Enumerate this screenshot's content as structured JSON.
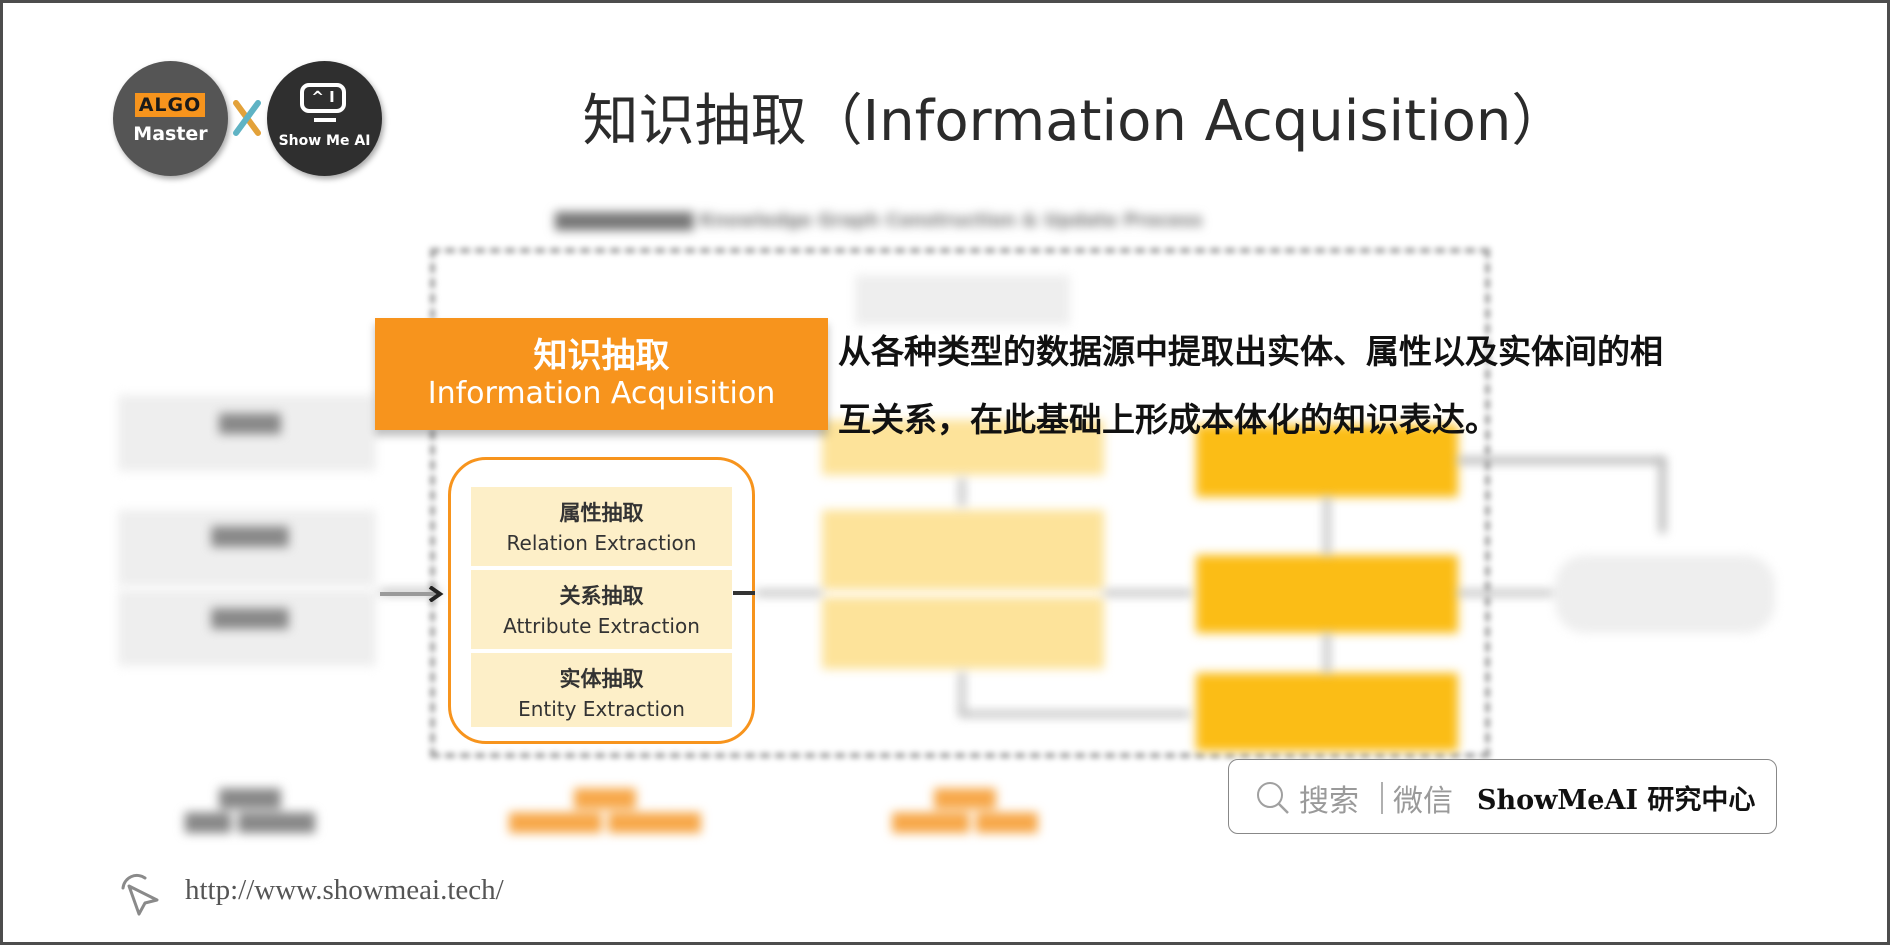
{
  "logos": {
    "algo_badge": "ALGO",
    "algo_sub": "Master",
    "cross": "x",
    "showmeai_screen": "^ I",
    "showmeai_text": "Show Me AI"
  },
  "title": "知识抽取（Information Acquisition）",
  "header_box": {
    "zh": "知识抽取",
    "en": "Information Acquisition"
  },
  "description": {
    "line1": "从各种类型的数据源中提取出实体、属性以及实体间的相",
    "line2": "互关系，在此基础上形成本体化的知识表达。"
  },
  "extraction_items": [
    {
      "zh": "属性抽取",
      "en": "Relation Extraction"
    },
    {
      "zh": "关系抽取",
      "en": "Attribute Extraction"
    },
    {
      "zh": "实体抽取",
      "en": "Entity Extraction"
    }
  ],
  "search": {
    "icon": "search-icon",
    "hint_1": "搜索",
    "hint_2": "微信",
    "brand": "ShowMeAI 研究中心"
  },
  "footer": {
    "icon": "cursor-click-icon",
    "url": "http://www.showmeai.tech/"
  },
  "colors": {
    "accent_orange": "#f7941d",
    "card_fill": "#fdefc8",
    "frame_border": "#4d4d4d",
    "title_text": "#2b2b2b"
  }
}
